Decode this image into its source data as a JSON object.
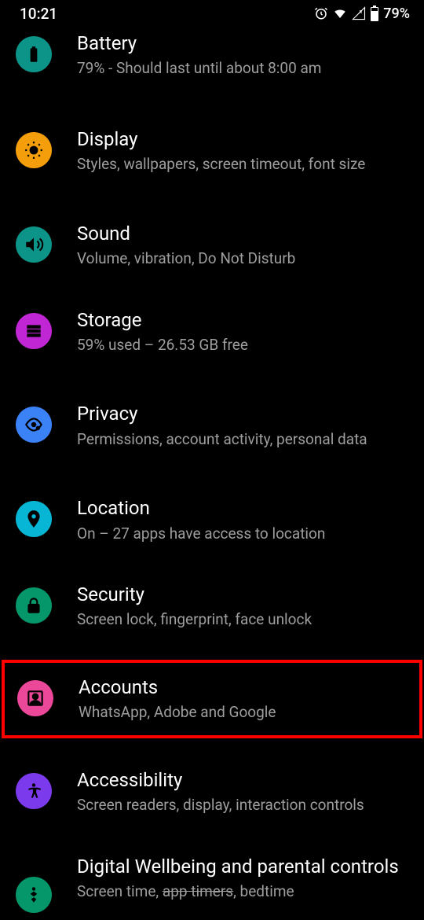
{
  "statusBar": {
    "time": "10:21",
    "battery": "79%"
  },
  "items": [
    {
      "title": "Battery",
      "subtitle": "79% - Should last until about 8:00 am",
      "iconName": "battery-icon",
      "bgColor": "#0d9488"
    },
    {
      "title": "Display",
      "subtitle": "Styles, wallpapers, screen timeout, font size",
      "iconName": "display-icon",
      "bgColor": "#f59e0b"
    },
    {
      "title": "Sound",
      "subtitle": "Volume, vibration, Do Not Disturb",
      "iconName": "sound-icon",
      "bgColor": "#0d9488"
    },
    {
      "title": "Storage",
      "subtitle": "59% used – 26.53 GB free",
      "iconName": "storage-icon",
      "bgColor": "#c026d3"
    },
    {
      "title": "Privacy",
      "subtitle": "Permissions, account activity, personal data",
      "iconName": "privacy-icon",
      "bgColor": "#3b82f6"
    },
    {
      "title": "Location",
      "subtitle": "On – 27 apps have access to location",
      "iconName": "location-icon",
      "bgColor": "#06b6d4"
    },
    {
      "title": "Security",
      "subtitle": "Screen lock, fingerprint, face unlock",
      "iconName": "security-icon",
      "bgColor": "#059669"
    },
    {
      "title": "Accounts",
      "subtitle": "WhatsApp, Adobe and Google",
      "iconName": "accounts-icon",
      "bgColor": "#ec4899"
    },
    {
      "title": "Accessibility",
      "subtitle": "Screen readers, display, interaction controls",
      "iconName": "accessibility-icon",
      "bgColor": "#7c3aed"
    },
    {
      "title": "Digital Wellbeing and parental controls",
      "subtitlePrefix": "Screen time, ",
      "subtitleStrike": "app timers",
      "subtitleSuffix": ", bedtime",
      "iconName": "wellbeing-icon",
      "bgColor": "#059669"
    }
  ]
}
